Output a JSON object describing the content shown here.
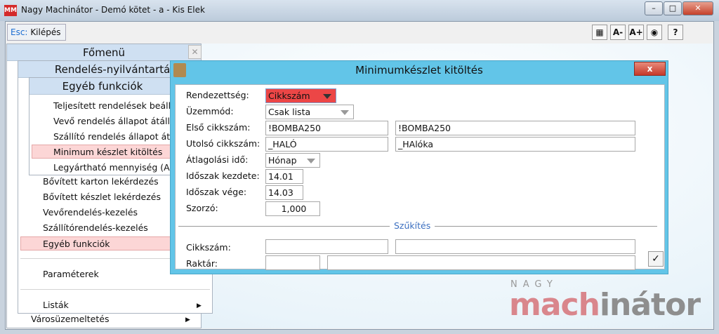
{
  "window": {
    "title": "Nagy Machinátor - Demó kötet - a - Kis Elek",
    "app_icon": "MM"
  },
  "toolbar": {
    "esc_key": "Esc:",
    "esc_label": "Kilépés",
    "icons": [
      "grid-icon",
      "font-decrease-icon",
      "font-increase-icon",
      "lifebuoy-icon",
      "help-icon"
    ],
    "font_dec": "A-",
    "font_inc": "A+",
    "help": "?"
  },
  "fomenu": {
    "title": "Főmenü",
    "close": "✕",
    "items": [
      {
        "label": "Városüzemeltetés"
      }
    ]
  },
  "rendeles": {
    "title": "Rendelés-nyilvántartás",
    "items": [
      "Bővített karton lekérdezés",
      "Bővített készlet lekérdezés",
      "Vevőrendelés-kezelés",
      "Szállítórendelés-kezelés",
      "Egyéb funkciók",
      "Paraméterek",
      "Listák"
    ]
  },
  "egyeb": {
    "title": "Egyéb funkciók",
    "items": [
      "Teljesített rendelések beállítása",
      "Vevő rendelés állapot átállítása",
      "Szállító rendelés állapot átállítása",
      "Minimum készlet kitöltés",
      "Legyártható mennyiség (Alkatrész)"
    ]
  },
  "dialog": {
    "title": "Minimumkészlet kitöltés",
    "close": "x",
    "labels": {
      "order": "Rendezettség:",
      "mode": "Üzemmód:",
      "first": "Első cikkszám:",
      "last": "Utolsó cikkszám:",
      "avg": "Átlagolási idő:",
      "start": "Időszak kezdete:",
      "end": "Időszak vége:",
      "mult": "Szorzó:",
      "filter": "Szűkítés",
      "item": "Cikkszám:",
      "stock": "Raktár:"
    },
    "values": {
      "order": "Cikkszám",
      "mode": "Csak lista",
      "first": "!BOMBA250",
      "first_name": "!BOMBA250",
      "last": "_HALÓ",
      "last_name": "_HAlóka",
      "avg": "Hónap",
      "start": "14.01",
      "end": "14.03",
      "mult": "1,000",
      "item": "",
      "item_name": "",
      "stock": "",
      "stock_name": ""
    },
    "ok": "✓"
  },
  "logo": {
    "top": "NAGY",
    "a": "mach",
    "b": "inátor"
  }
}
